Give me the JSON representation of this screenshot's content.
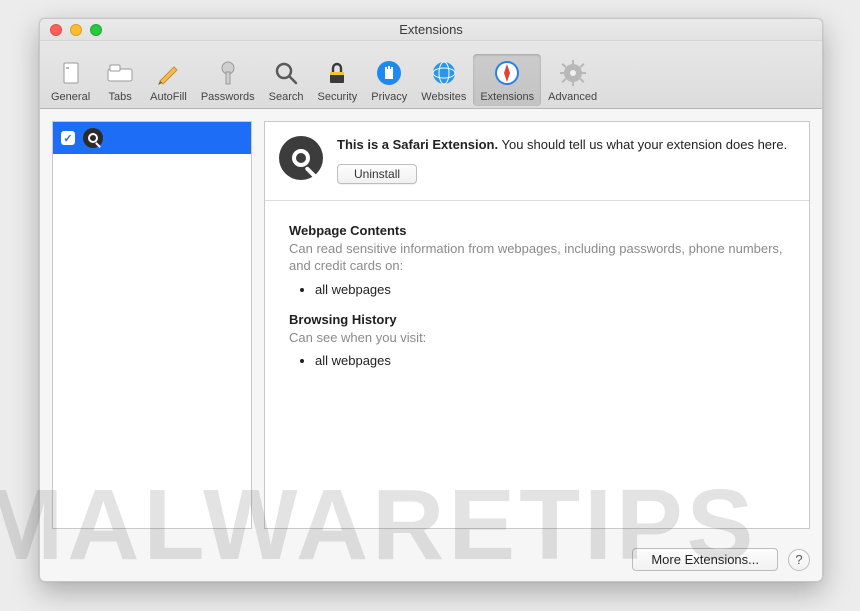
{
  "window": {
    "title": "Extensions"
  },
  "toolbar": {
    "items": [
      {
        "label": "General"
      },
      {
        "label": "Tabs"
      },
      {
        "label": "AutoFill"
      },
      {
        "label": "Passwords"
      },
      {
        "label": "Search"
      },
      {
        "label": "Security"
      },
      {
        "label": "Privacy"
      },
      {
        "label": "Websites"
      },
      {
        "label": "Extensions"
      },
      {
        "label": "Advanced"
      }
    ]
  },
  "sidebar": {
    "items": [
      {
        "checked": true,
        "icon": "magnifier",
        "label": ""
      }
    ]
  },
  "detail": {
    "description_bold": "This is a Safari Extension.",
    "description_rest": " You should tell us what your extension does here.",
    "uninstall_label": "Uninstall",
    "permissions": {
      "webpage": {
        "heading": "Webpage Contents",
        "sub": "Can read sensitive information from webpages, including passwords, phone numbers, and credit cards on:",
        "items": [
          "all webpages"
        ]
      },
      "history": {
        "heading": "Browsing History",
        "sub": "Can see when you visit:",
        "items": [
          "all webpages"
        ]
      }
    }
  },
  "footer": {
    "more_label": "More Extensions...",
    "help_label": "?"
  },
  "watermark": "MALWARETIPS"
}
